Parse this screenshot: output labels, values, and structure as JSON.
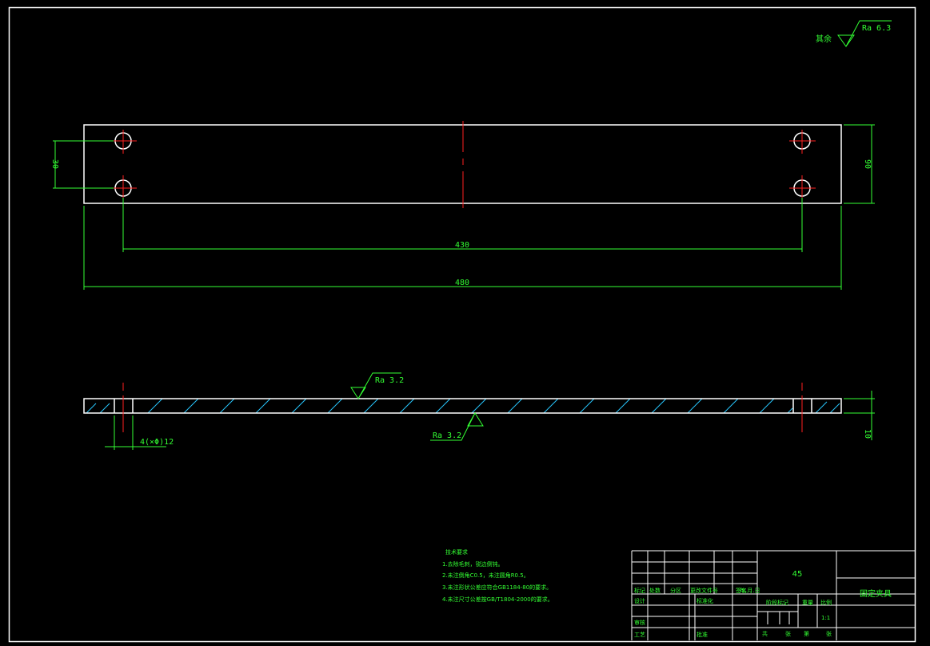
{
  "roughness": {
    "general_prefix": "其余",
    "general": "Ra 6.3",
    "top_face": "Ra 3.2",
    "bottom_face": "Ra 3.2"
  },
  "dimensions": {
    "hole_spacing_vertical": "30",
    "plate_height": "90",
    "hole_spacing_horizontal": "430",
    "plate_length": "480",
    "holes": "4(×Φ)12",
    "thickness": "10"
  },
  "technical_requirements": {
    "title": "技术要求",
    "items": [
      "1.去除毛刺，锐边倒钝。",
      "2.未注倒角C0.5，未注圆角R0.5。",
      "3.未注形状公差应符合GB1184-80的要求。",
      "4.未注尺寸公差按GB/T1804-2000的要求。"
    ]
  },
  "title_block": {
    "material": "45",
    "part_name": "固定夹具",
    "header_labels": [
      "标记",
      "处数",
      "分区",
      "更改文件号",
      "签名",
      "年.月.日"
    ],
    "design": "设计",
    "standardization": "标准化",
    "review": "审核",
    "process": "工艺",
    "approve": "批准",
    "stage_mark": "阶段标记",
    "weight": "重量",
    "scale_label": "比例",
    "scale": "1:1",
    "total_sheets": "共",
    "sheet_unit_1": "张",
    "sheet_no": "第",
    "sheet_unit_2": "张"
  }
}
